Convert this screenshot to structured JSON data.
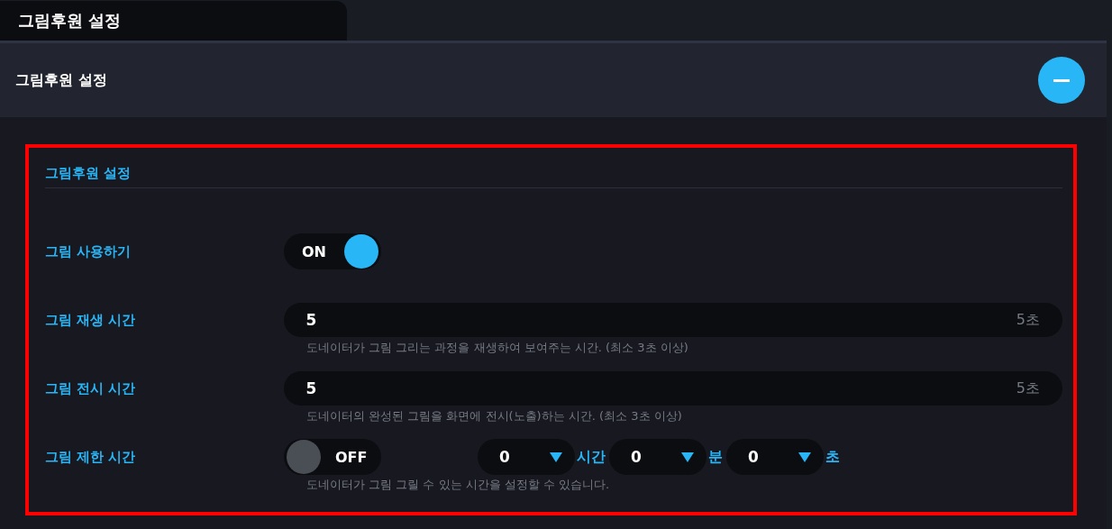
{
  "tab": {
    "label": "그림후원 설정",
    "selected": true
  },
  "panel": {
    "title": "그림후원 설정",
    "expanded": true
  },
  "section": {
    "title": "그림후원 설정"
  },
  "rows": [
    {
      "kind": "toggle",
      "label": "그림 사용하기",
      "on": true,
      "state_text": "ON"
    },
    {
      "kind": "input",
      "label": "그림 재생 시간",
      "value": "5",
      "suffix": "5초",
      "hint": "도네이터가 그림 그리는 과정을 재생하여 보여주는 시간. (최소 3초 이상)"
    },
    {
      "kind": "input",
      "label": "그림 전시 시간",
      "value": "5",
      "suffix": "5초",
      "hint": "도네이터의 완성된 그림을 화면에 전시(노출)하는 시간. (최소 3초 이상)"
    },
    {
      "kind": "timer",
      "label": "그림 제한 시간",
      "on": false,
      "state_text": "OFF",
      "selects": [
        {
          "value": "0",
          "unit": "시간"
        },
        {
          "value": "0",
          "unit": "분"
        },
        {
          "value": "0",
          "unit": "초"
        }
      ],
      "hint": "도네이터가 그림 그릴 수 있는 시간을 설정할 수 있습니다."
    }
  ]
}
